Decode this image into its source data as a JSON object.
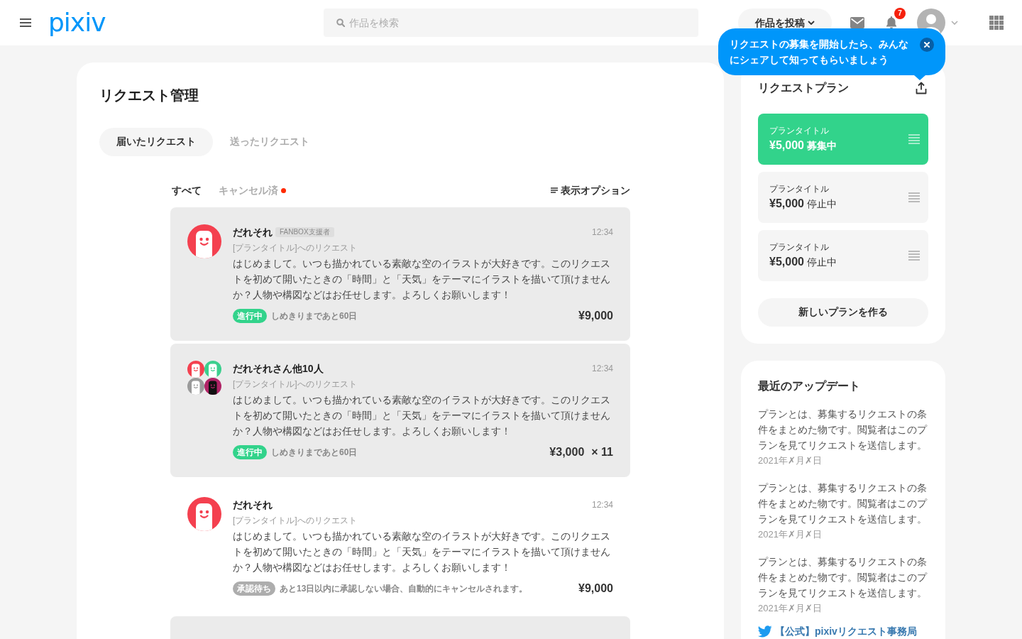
{
  "header": {
    "logo": "pixiv",
    "search": {
      "placeholder": "作品を検索"
    },
    "post_button": "作品を投稿",
    "notification_count": "7"
  },
  "tooltip": {
    "text": "リクエストの募集を開始したら、みんなにシェアして知ってもらいましょう"
  },
  "page": {
    "title": "リクエスト管理"
  },
  "tabs": [
    {
      "label": "届いたリクエスト",
      "selected": true
    },
    {
      "label": "送ったリクエスト",
      "selected": false
    }
  ],
  "filters": [
    {
      "label": "すべて",
      "selected": true,
      "dot": false
    },
    {
      "label": "キャンセル済",
      "selected": false,
      "dot": true
    }
  ],
  "display_options": "表示オプション",
  "requests": [
    {
      "unread": true,
      "avatars": [
        {
          "color": "#f4404f",
          "kind": "light"
        }
      ],
      "name": "だれそれ",
      "badge": "FANBOX支援者",
      "time": "12:34",
      "plan": "[プランタイトル]へのリクエスト",
      "message": "はじめまして。いつも描かれている素敵な空のイラストが大好きです。このリクエストを初めて開いたときの「時間」と「天気」をテーマにイラストを描いて頂けませんか？人物や構図などはお任せします。よろしくお願いします！",
      "status": {
        "kind": "active",
        "label": "進行中"
      },
      "note": "しめきりまであと60日",
      "price": "¥9,000"
    },
    {
      "unread": true,
      "avatars": [
        {
          "color": "#f4404f",
          "kind": "light"
        },
        {
          "color": "#3ccf8e",
          "kind": "light"
        },
        {
          "color": "#9a9a9a",
          "kind": "light"
        },
        {
          "color": "#b02466",
          "kind": "dark"
        }
      ],
      "name": "だれそれさん他10人",
      "time": "12:34",
      "plan": "[プランタイトル]へのリクエスト",
      "message": "はじめまして。いつも描かれている素敵な空のイラストが大好きです。このリクエストを初めて開いたときの「時間」と「天気」をテーマにイラストを描いて頂けませんか？人物や構図などはお任せします。よろしくお願いします！",
      "status": {
        "kind": "active",
        "label": "進行中"
      },
      "note": "しめきりまであと60日",
      "price": "¥3,000",
      "quantity": "× 11"
    },
    {
      "unread": false,
      "avatars": [
        {
          "color": "#f4404f",
          "kind": "light"
        }
      ],
      "name": "だれそれ",
      "time": "12:34",
      "plan": "[プランタイトル]へのリクエスト",
      "message": "はじめまして。いつも描かれている素敵な空のイラストが大好きです。このリクエストを初めて開いたときの「時間」と「天気」をテーマにイラストを描いて頂けませんか？人物や構図などはお任せします。よろしくお願いします！",
      "status": {
        "kind": "pending",
        "label": "承認待ち"
      },
      "note": "あと13日以内に承認しない場合、自動的にキャンセルされます。",
      "price": "¥9,000"
    },
    {
      "unread": true
    }
  ],
  "plans_panel": {
    "title": "リクエストプラン",
    "plans": [
      {
        "title": "プランタイトル",
        "price": "¥5,000",
        "status": "募集中",
        "active": true
      },
      {
        "title": "プランタイトル",
        "price": "¥5,000",
        "status": "停止中",
        "active": false
      },
      {
        "title": "プランタイトル",
        "price": "¥5,000",
        "status": "停止中",
        "active": false
      }
    ],
    "create_button": "新しいプランを作る"
  },
  "updates_panel": {
    "title": "最近のアップデート",
    "items": [
      {
        "text": "プランとは、募集するリクエストの条件をまとめた物です。閲覧者はこのプランを見てリクエストを送信します。",
        "date": "2021年✗月✗日"
      },
      {
        "text": "プランとは、募集するリクエストの条件をまとめた物です。閲覧者はこのプランを見てリクエストを送信します。",
        "date": "2021年✗月✗日"
      },
      {
        "text": "プランとは、募集するリクエストの条件をまとめた物です。閲覧者はこのプランを見てリクエストを送信します。",
        "date": "2021年✗月✗日"
      }
    ],
    "link": "【公式】pixivリクエスト事務局"
  }
}
